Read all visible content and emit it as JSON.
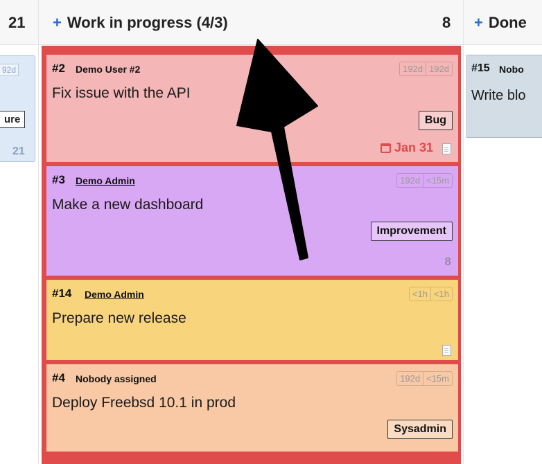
{
  "columns": {
    "left": {
      "count": "21",
      "card_est": "92d",
      "card_tag": "ure",
      "card_count": "21"
    },
    "wip": {
      "title": "Work in progress (4/3)",
      "count": "8"
    },
    "done": {
      "title": "Done"
    }
  },
  "cards": [
    {
      "num": "#2",
      "owner": "Demo User #2",
      "title": "Fix issue with the API",
      "est": [
        "192d",
        "192d"
      ],
      "tag": "Bug",
      "due": "Jan 31"
    },
    {
      "num": "#3",
      "owner": "Demo Admin",
      "title": "Make a new dashboard",
      "est": [
        "192d",
        "<15m"
      ],
      "tag": "Improvement",
      "count": "8"
    },
    {
      "num": "#14",
      "owner": "Demo Admin",
      "title": "Prepare new release",
      "est": [
        "<1h",
        "<1h"
      ]
    },
    {
      "num": "#4",
      "owner": "Nobody assigned",
      "title": "Deploy Freebsd 10.1 in prod",
      "est": [
        "192d",
        "<15m"
      ],
      "tag": "Sysadmin"
    }
  ],
  "done_card": {
    "num": "#15",
    "owner": "Nobo",
    "title": "Write blo"
  },
  "colors": {
    "wip_border": "#e04b4b",
    "bug": "#f4b6b6",
    "improvement": "#d9a8f5",
    "release": "#f8d57d",
    "sysadmin": "#f8c9a4",
    "plus": "#2b6cd9"
  }
}
